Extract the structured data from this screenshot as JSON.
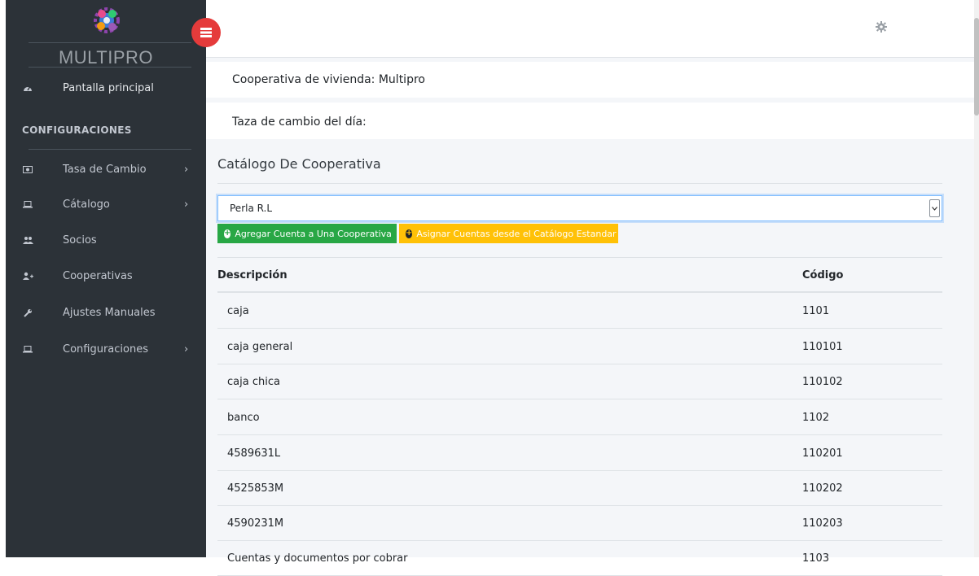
{
  "sidebar": {
    "brand": "MULTIPRO",
    "home_label": "Pantalla principal",
    "section_header": "CONFIGURACIONES",
    "items": [
      {
        "label": "Tasa de Cambio",
        "icon": "money-icon",
        "has_submenu": true
      },
      {
        "label": "Cátalogo",
        "icon": "laptop-icon",
        "has_submenu": true
      },
      {
        "label": "Socios",
        "icon": "users-icon",
        "has_submenu": false
      },
      {
        "label": "Cooperativas",
        "icon": "user-plus-icon",
        "has_submenu": false
      },
      {
        "label": "Ajustes Manuales",
        "icon": "wrench-icon",
        "has_submenu": false
      },
      {
        "label": "Configuraciones",
        "icon": "laptop-icon",
        "has_submenu": true
      }
    ],
    "chevron": "›"
  },
  "header": {
    "cooperativa": "Cooperativa de vivienda: Multipro",
    "taza": "Taza de cambio del día:"
  },
  "main": {
    "title": "Catálogo De Cooperativa",
    "select_value": "Perla R.L",
    "add_button": "Agregar Cuenta a Una Cooperativa",
    "assign_button": "Asignar Cuentas desde el Catálogo Estandar",
    "table": {
      "headers": [
        "Descripción",
        "Código"
      ],
      "rows": [
        [
          "caja",
          "1101"
        ],
        [
          "caja general",
          "110101"
        ],
        [
          "caja chica",
          "110102"
        ],
        [
          "banco",
          "1102"
        ],
        [
          "4589631L",
          "110201"
        ],
        [
          "4525853M",
          "110202"
        ],
        [
          "4590231M",
          "110203"
        ],
        [
          "Cuentas y documentos por cobrar",
          "1103"
        ]
      ]
    }
  },
  "colors": {
    "sidebar_bg": "#2c3238",
    "toggle_red": "#e53b3b",
    "btn_green": "#28a745",
    "btn_yellow": "#ffc107",
    "content_bg": "#f4f6f9"
  }
}
